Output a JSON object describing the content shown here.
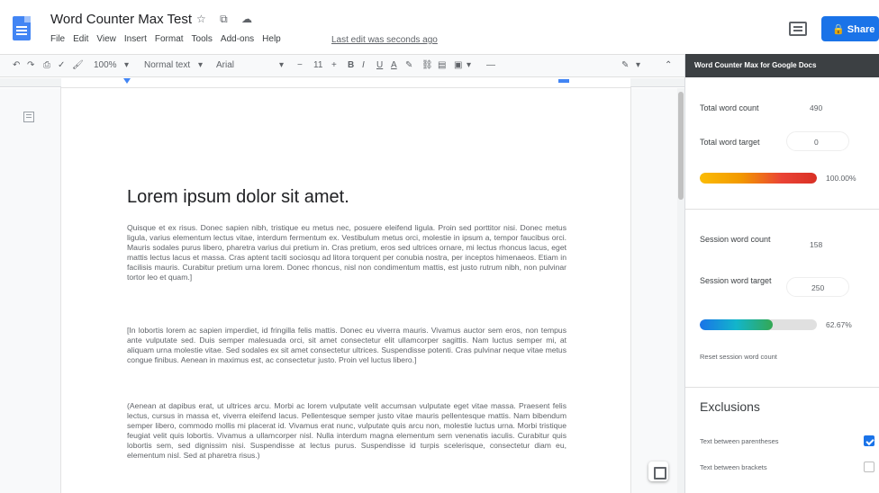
{
  "app": {
    "doc_title": "Word Counter Max Test",
    "title_icons": "☆ ⧉ ☁",
    "last_edit": "Last edit was seconds ago",
    "share_label": "Share"
  },
  "menu": [
    "File",
    "Edit",
    "View",
    "Insert",
    "Format",
    "Tools",
    "Add-ons",
    "Help"
  ],
  "toolbar": {
    "zoom": "100%",
    "style": "Normal text",
    "font": "Arial",
    "font_size": "11",
    "bold": "B",
    "italic": "I",
    "underline": "U",
    "text_color": "A"
  },
  "document": {
    "heading": "Lorem ipsum dolor sit amet.",
    "paragraphs": [
      "Quisque et ex risus. Donec sapien nibh, tristique eu metus nec, posuere eleifend ligula. Proin sed porttitor nisi. Donec metus ligula, varius elementum lectus vitae, interdum fermentum ex. Vestibulum metus orci, molestie in ipsum a, tempor faucibus orci. Mauris sodales purus libero, pharetra varius dui pretium in. Cras pretium, eros sed ultrices ornare, mi lectus rhoncus lacus, eget mattis lectus lacus et massa. Cras aptent taciti sociosqu ad litora torquent per conubia nostra, per inceptos himenaeos. Etiam in facilisis mauris. Curabitur pretium urna lorem. Donec rhoncus, nisl non condimentum mattis, est justo rutrum nibh, non pulvinar tortor leo et quam.]",
      "[In lobortis lorem ac sapien imperdiet, id fringilla felis mattis. Donec eu viverra mauris. Vivamus auctor sem eros, non tempus ante vulputate sed. Duis semper malesuada orci, sit amet consectetur elit ullamcorper sagittis. Nam luctus semper mi, at aliquam urna molestie vitae. Sed sodales ex sit amet consectetur ultrices. Suspendisse potenti. Cras pulvinar neque vitae metus congue finibus. Aenean in maximus est, ac consectetur justo. Proin vel luctus libero.]",
      "(Aenean at dapibus erat, ut ultrices arcu. Morbi ac lorem vulputate velit accumsan vulputate eget vitae massa. Praesent felis lectus, cursus in massa et, viverra eleifend lacus. Pellentesque semper justo vitae mauris pellentesque mattis. Nam bibendum semper libero, commodo mollis mi placerat id. Vivamus erat nunc, vulputate quis arcu non, molestie luctus urna. Morbi tristique feugiat velit quis lobortis. Vivamus a ullamcorper nisl. Nulla interdum magna elementum sem venenatis iaculis. Curabitur quis lobortis sem, sed dignissim nisi. Suspendisse at lectus purus. Suspendisse id turpis scelerisque, consectetur diam eu, elementum nisl. Sed at pharetra risus.)"
    ]
  },
  "sidebar": {
    "header": "Word Counter Max for Google Docs",
    "total_word_count_label": "Total word count",
    "total_word_count_value": "490",
    "total_word_target_label": "Total word target",
    "total_word_target_value": "0",
    "total_progress_label": "100.00%",
    "total_progress_fraction": 1.0,
    "session_word_count_label": "Session word count",
    "session_word_count_value": "158",
    "session_word_target_label": "Session word target",
    "session_word_target_value": "250",
    "session_progress_label": "62.67%",
    "session_progress_fraction": 0.6267,
    "reset_link": "Reset session word count",
    "exclusions_title": "Exclusions",
    "exclusions": [
      {
        "label": "Text between parentheses",
        "checked": true
      },
      {
        "label": "Text between brackets",
        "checked": false
      }
    ]
  },
  "colors": {
    "share_blue": "#1a73e8",
    "sidebar_header": "#3c4043",
    "checkbox_blue": "#1a73e8"
  }
}
